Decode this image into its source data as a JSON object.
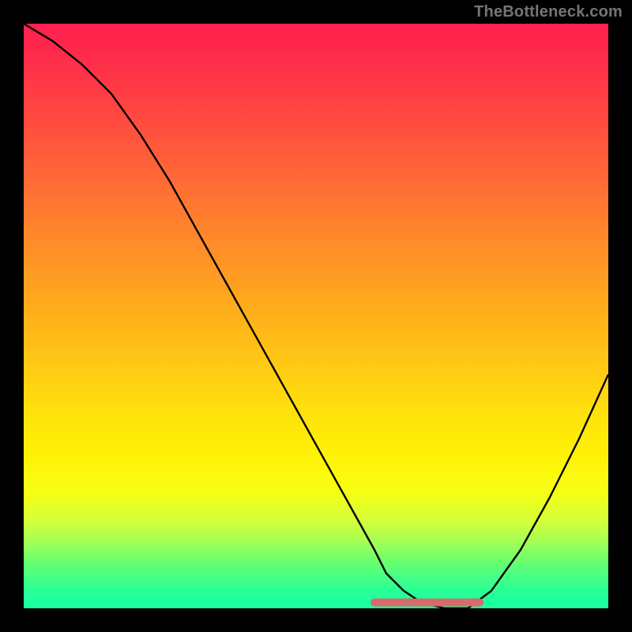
{
  "watermark": "TheBottleneck.com",
  "colors": {
    "background": "#000000",
    "curve": "#000000",
    "marker": "#d96a6a",
    "watermark_text": "#757575"
  },
  "chart_data": {
    "type": "line",
    "title": "",
    "xlabel": "",
    "ylabel": "",
    "xlim": [
      0,
      100
    ],
    "ylim": [
      0,
      100
    ],
    "grid": false,
    "series": [
      {
        "name": "curve",
        "x": [
          0,
          5,
          10,
          15,
          20,
          25,
          30,
          35,
          40,
          45,
          50,
          55,
          60,
          62,
          65,
          68,
          72,
          76,
          80,
          85,
          90,
          95,
          100
        ],
        "y": [
          100,
          97,
          93,
          88,
          81,
          73,
          64,
          55,
          46,
          37,
          28,
          19,
          10,
          6,
          3,
          1,
          0,
          0,
          3,
          10,
          19,
          29,
          40
        ]
      }
    ],
    "marker_segment": {
      "name": "optimal-range",
      "x": [
        60,
        78
      ],
      "y": [
        1,
        1
      ]
    },
    "gradient_stops": [
      {
        "pos": 0.0,
        "color": "#ff1f4f"
      },
      {
        "pos": 0.5,
        "color": "#ffc000"
      },
      {
        "pos": 0.8,
        "color": "#f7ff14"
      },
      {
        "pos": 1.0,
        "color": "#12ffa0"
      }
    ]
  }
}
